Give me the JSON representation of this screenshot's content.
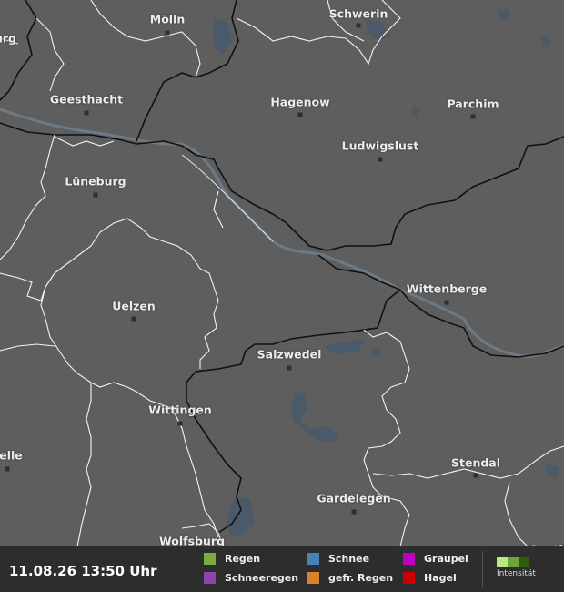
{
  "map": {
    "cities": [
      {
        "name": "Mölln"
      },
      {
        "name": "Schwerin"
      },
      {
        "name": "urg"
      },
      {
        "name": "Geesthacht"
      },
      {
        "name": "Hagenow"
      },
      {
        "name": "Parchim"
      },
      {
        "name": "Ludwigslust"
      },
      {
        "name": "Lüneburg"
      },
      {
        "name": "Uelzen"
      },
      {
        "name": "Wittenberge"
      },
      {
        "name": "Salzwedel"
      },
      {
        "name": "Wittingen"
      },
      {
        "name": "elle"
      },
      {
        "name": "Stendal"
      },
      {
        "name": "Gardelegen"
      },
      {
        "name": "Wolfsburg"
      },
      {
        "name": "Genth"
      }
    ]
  },
  "legend": {
    "timestamp": "11.08.26 13:50 Uhr",
    "items": [
      {
        "label": "Regen",
        "color": "#7cab3f"
      },
      {
        "label": "Schneeregen",
        "color": "#8e44ad"
      },
      {
        "label": "Schnee",
        "color": "#4682b4"
      },
      {
        "label": "gefr. Regen",
        "color": "#d9822b"
      },
      {
        "label": "Graupel",
        "color": "#c000c0"
      },
      {
        "label": "Hagel",
        "color": "#cc0000"
      }
    ],
    "intensity_label": "Intensität",
    "intensity_colors": [
      "#b9e986",
      "#6fa538",
      "#2f5d10"
    ]
  }
}
